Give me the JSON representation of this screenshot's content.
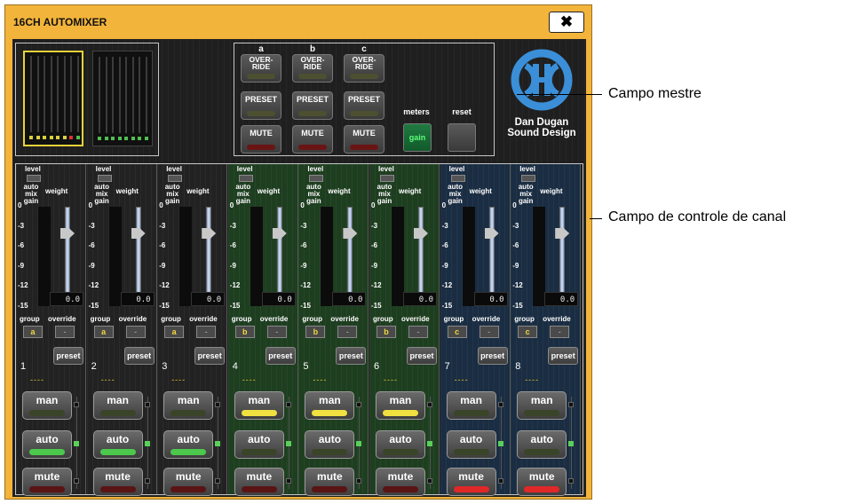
{
  "window": {
    "title": "16CH AUTOMIXER",
    "close_icon": "close-icon"
  },
  "master": {
    "groups": [
      {
        "letter": "a",
        "override": "OVER-\nRIDE",
        "preset": "PRESET",
        "mute": "MUTE"
      },
      {
        "letter": "b",
        "override": "OVER-\nRIDE",
        "preset": "PRESET",
        "mute": "MUTE"
      },
      {
        "letter": "c",
        "override": "OVER-\nRIDE",
        "preset": "PRESET",
        "mute": "MUTE"
      }
    ],
    "meters_label": "meters",
    "gain_label": "gain",
    "reset_label": "reset",
    "logo_line1": "Dan Dugan",
    "logo_line2": "Sound Design"
  },
  "channel_labels": {
    "level": "level",
    "auto_mix_gain": "auto mix gain",
    "weight": "weight",
    "group": "group",
    "override": "override",
    "preset": "preset",
    "man": "man",
    "auto": "auto",
    "mute": "mute",
    "scale": [
      "0",
      "-3",
      "-6",
      "-9",
      "-12",
      "-15"
    ]
  },
  "channels": [
    {
      "number": "1",
      "group": "a",
      "override": "-",
      "weight": "0.0",
      "preset_value": "----",
      "man_on": false,
      "auto_on": true,
      "mute_on": false
    },
    {
      "number": "2",
      "group": "a",
      "override": "-",
      "weight": "0.0",
      "preset_value": "----",
      "man_on": false,
      "auto_on": true,
      "mute_on": false
    },
    {
      "number": "3",
      "group": "a",
      "override": "-",
      "weight": "0.0",
      "preset_value": "----",
      "man_on": false,
      "auto_on": true,
      "mute_on": false
    },
    {
      "number": "4",
      "group": "b",
      "override": "-",
      "weight": "0.0",
      "preset_value": "----",
      "man_on": true,
      "auto_on": false,
      "mute_on": false
    },
    {
      "number": "5",
      "group": "b",
      "override": "-",
      "weight": "0.0",
      "preset_value": "----",
      "man_on": true,
      "auto_on": false,
      "mute_on": false
    },
    {
      "number": "6",
      "group": "b",
      "override": "-",
      "weight": "0.0",
      "preset_value": "----",
      "man_on": true,
      "auto_on": false,
      "mute_on": false
    },
    {
      "number": "7",
      "group": "c",
      "override": "-",
      "weight": "0.0",
      "preset_value": "----",
      "man_on": false,
      "auto_on": false,
      "mute_on": true
    },
    {
      "number": "8",
      "group": "c",
      "override": "-",
      "weight": "0.0",
      "preset_value": "----",
      "man_on": false,
      "auto_on": false,
      "mute_on": true
    }
  ],
  "callouts": {
    "master": "Campo mestre",
    "channel": "Campo de controle de canal"
  },
  "colors": {
    "titlebar": "#f2b43a",
    "group_a": "#222222",
    "group_b": "#1e3e20",
    "group_c": "#1a2d42",
    "led_green": "#4cc84c",
    "led_yellow": "#f0e040",
    "led_red": "#e02828",
    "led_off": "#3a3a2a"
  }
}
